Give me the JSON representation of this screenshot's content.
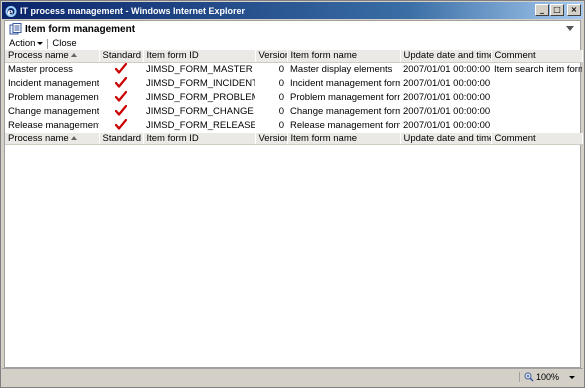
{
  "window": {
    "title": "IT process management - Windows Internet Explorer",
    "buttons": {
      "minimize": "_",
      "maximize": "□",
      "close": "×"
    }
  },
  "header": {
    "title": "Item form management"
  },
  "toolbar": {
    "action_label": "Action",
    "close_label": "Close"
  },
  "table": {
    "columns": [
      "Process name",
      "Standard",
      "Item form ID",
      "Version",
      "Item form name",
      "Update date and time",
      "Comment"
    ],
    "rows": [
      {
        "process": "Master process",
        "standard": true,
        "id": "JIMSD_FORM_MASTER",
        "version": "0",
        "name": "Master display elements",
        "updated": "2007/01/01 00:00:00",
        "comment": "Item search item form"
      },
      {
        "process": "Incident management",
        "standard": true,
        "id": "JIMSD_FORM_INCIDENT",
        "version": "0",
        "name": "Incident management form",
        "updated": "2007/01/01 00:00:00",
        "comment": ""
      },
      {
        "process": "Problem management",
        "standard": true,
        "id": "JIMSD_FORM_PROBLEM",
        "version": "0",
        "name": "Problem management form",
        "updated": "2007/01/01 00:00:00",
        "comment": ""
      },
      {
        "process": "Change management",
        "standard": true,
        "id": "JIMSD_FORM_CHANGE",
        "version": "0",
        "name": "Change management form",
        "updated": "2007/01/01 00:00:00",
        "comment": ""
      },
      {
        "process": "Release management",
        "standard": true,
        "id": "JIMSD_FORM_RELEASE",
        "version": "0",
        "name": "Release management form",
        "updated": "2007/01/01 00:00:00",
        "comment": ""
      }
    ]
  },
  "statusbar": {
    "zoom": "100%"
  },
  "colors": {
    "titlebar": "#0a246a",
    "check": "#cc0000",
    "header_bg": "#ebe9e5"
  }
}
